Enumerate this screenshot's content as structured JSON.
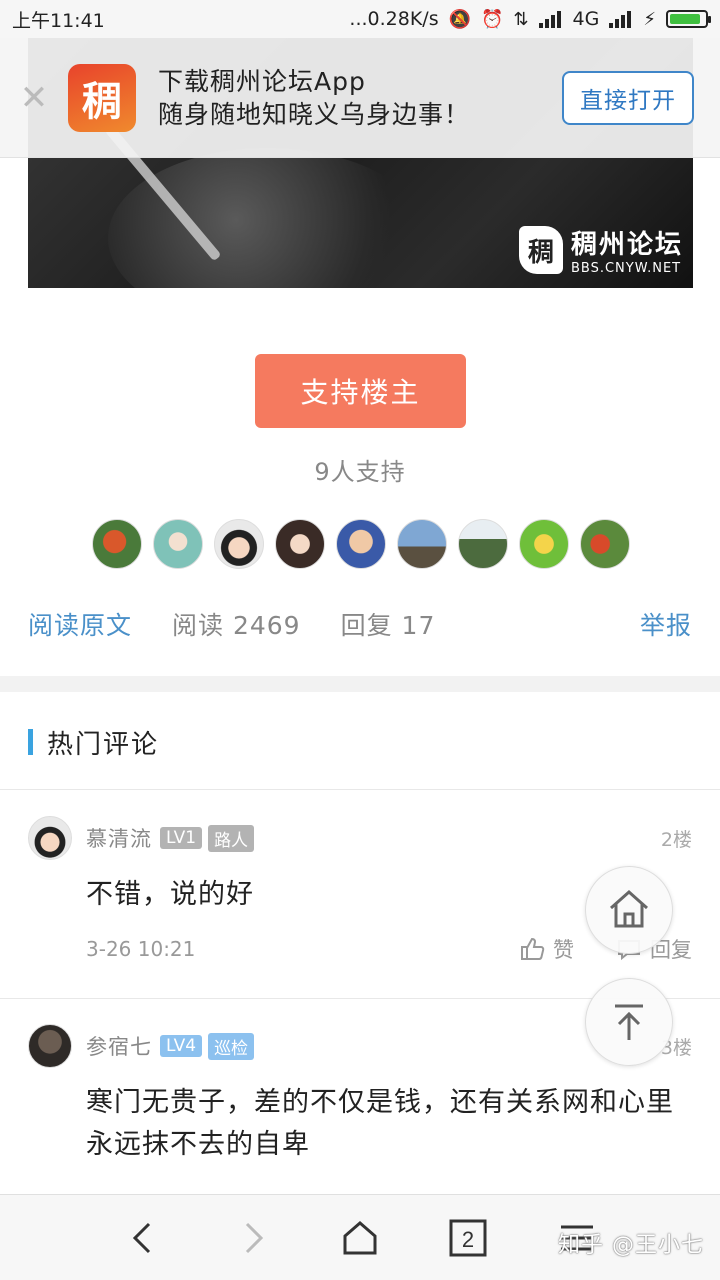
{
  "status_bar": {
    "time": "上午11:41",
    "network_speed": "...0.28K/s",
    "network_type": "4G",
    "icons": [
      "mute-icon",
      "alarm-icon",
      "data-transfer-icon",
      "signal-icon",
      "signal-icon",
      "charging-icon",
      "battery-icon"
    ],
    "battery_level": 0.9
  },
  "app_banner": {
    "line1": "下载稠州论坛App",
    "line2": "随身随地知晓义乌身边事！",
    "open_label": "直接打开",
    "close_icon": "close-icon"
  },
  "hero": {
    "logo_title": "稠州论坛",
    "logo_url": "BBS.CNYW.NET"
  },
  "support": {
    "button_label": "支持楼主",
    "count_text": "9人支持",
    "supporter_avatars": 9
  },
  "stats": {
    "read_original": "阅读原文",
    "reads": "阅读 2469",
    "replies": "回复 17",
    "report": "举报"
  },
  "hot_comments": {
    "title": "热门评论",
    "items": [
      {
        "name": "慕清流",
        "level": "LV1",
        "role": "路人",
        "floor": "2楼",
        "content": "不错，说的好",
        "time": "3-26 10:21",
        "like_label": "赞",
        "reply_label": "回复"
      },
      {
        "name": "参宿七",
        "level": "LV4",
        "role": "巡检",
        "floor": "3楼",
        "content": "寒门无贵子，差的不仅是钱，还有关系网和心里永远抹不去的自卑"
      }
    ]
  },
  "bottom_nav": {
    "tab_count": "2",
    "watermark": "知乎 @王小七"
  },
  "colors": {
    "accent_blue": "#4a90c9",
    "support_button": "#f57a5f",
    "section_bar": "#3aa3e0"
  }
}
